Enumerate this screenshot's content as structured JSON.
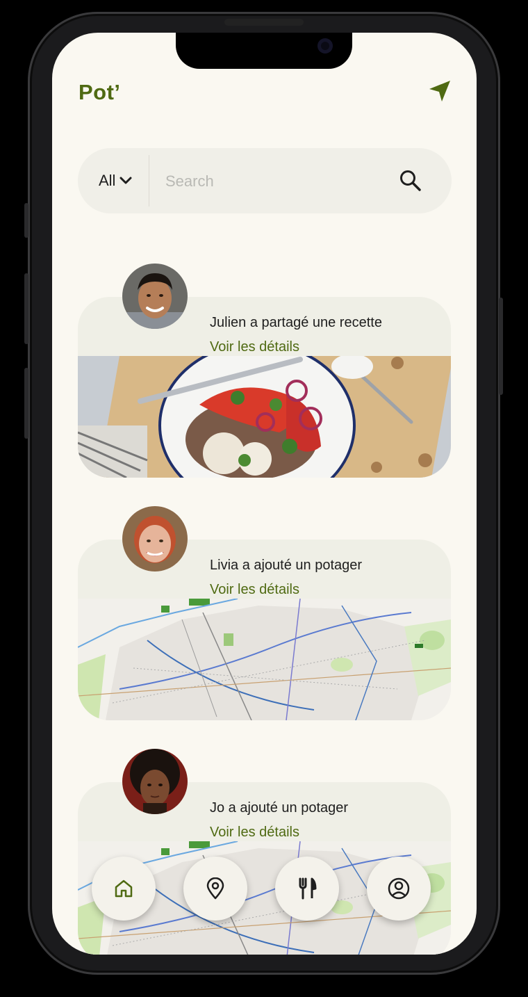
{
  "header": {
    "title": "Pot’"
  },
  "search": {
    "filter_label": "All",
    "placeholder": "Search"
  },
  "feed": [
    {
      "title": "Julien a partagé une recette",
      "link": "Voir les détails",
      "image": "salad-photo"
    },
    {
      "title": "Livia a ajouté un potager",
      "link": "Voir les détails",
      "image": "map"
    },
    {
      "title": "Jo a ajouté un potager",
      "link": "Voir les détails",
      "image": "map"
    }
  ],
  "bottom_nav": [
    {
      "icon": "home-icon",
      "active": true
    },
    {
      "icon": "location-pin-icon",
      "active": false
    },
    {
      "icon": "fork-knife-icon",
      "active": false
    },
    {
      "icon": "profile-icon",
      "active": false
    }
  ],
  "colors": {
    "brand": "#4f6a12",
    "background": "#faf8f1",
    "card": "#efefe6"
  }
}
